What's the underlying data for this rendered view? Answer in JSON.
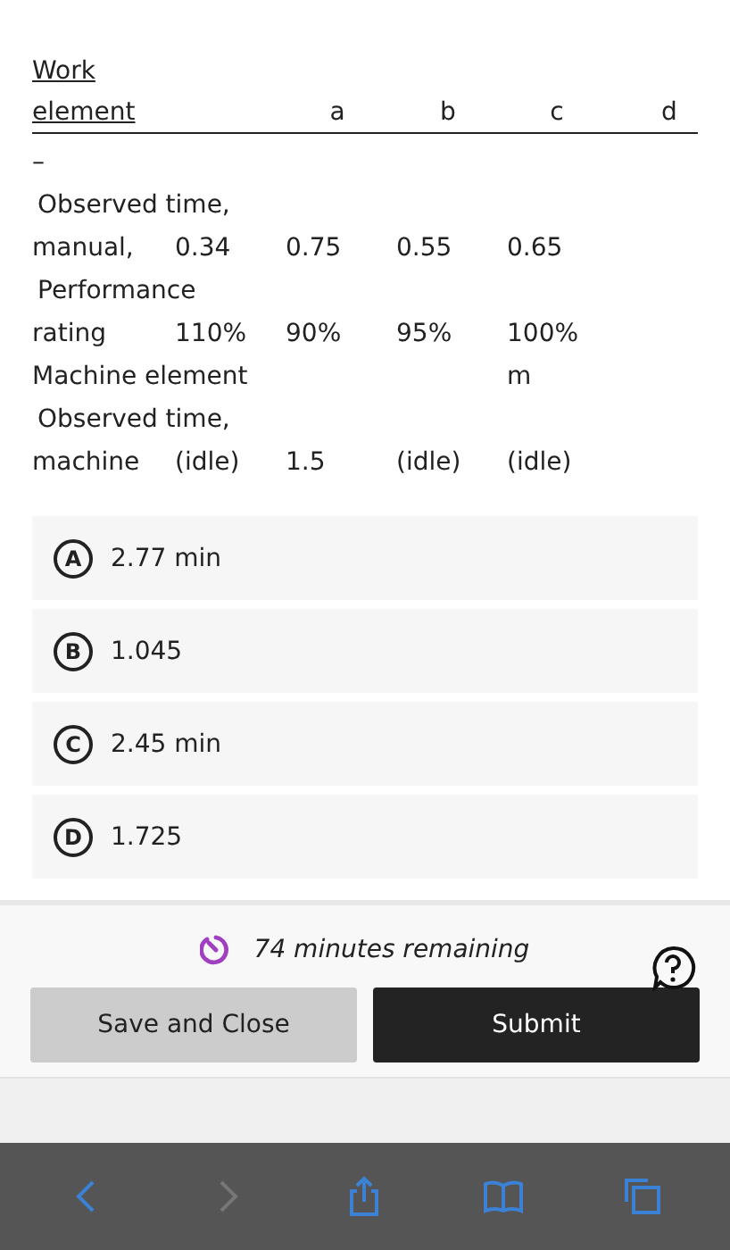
{
  "table": {
    "lines": [
      {
        "kind": "heading",
        "column_1": "Work"
      },
      {
        "kind": "header",
        "column_1": "element",
        "column_3": "a",
        "column_4": "b",
        "column_5": "c",
        "column_6": "d"
      },
      {
        "kind": "plain",
        "column_1": "–"
      },
      {
        "kind": "label",
        "column_1": "Observed time,"
      },
      {
        "kind": "values",
        "column_1": "manual,",
        "column_2": "0.34",
        "column_3": "0.75",
        "column_4": "0.55",
        "column_5": "0.65"
      },
      {
        "kind": "label",
        "column_1": "Performance"
      },
      {
        "kind": "values",
        "column_1": "rating",
        "column_2": "110%",
        "column_3": "90%",
        "column_4": "95%",
        "column_5": "100%"
      },
      {
        "kind": "values",
        "column_1": "Machine element",
        "column_5": "m"
      },
      {
        "kind": "label",
        "column_1": "Observed time,"
      },
      {
        "kind": "values",
        "column_1": "machine",
        "column_2": "(idle)",
        "column_3": "1.5",
        "column_4": "(idle)",
        "column_5": "(idle)"
      }
    ]
  },
  "options": [
    {
      "letter": "A",
      "text": "2.77 min"
    },
    {
      "letter": "B",
      "text": "1.045"
    },
    {
      "letter": "C",
      "text": "2.45 min"
    },
    {
      "letter": "D",
      "text": "1.725"
    }
  ],
  "footer": {
    "timer": "74 minutes remaining",
    "buttons": [
      {
        "label": "Save and Close",
        "kind": "secondary"
      },
      {
        "label": "Submit",
        "kind": "primary"
      }
    ]
  },
  "browser_toolbar": {
    "items": [
      {
        "kind": "back",
        "disabled": false
      },
      {
        "kind": "forward",
        "disabled": true
      },
      {
        "kind": "share",
        "disabled": false
      },
      {
        "kind": "bookmarks",
        "disabled": false
      },
      {
        "kind": "tabs",
        "disabled": false
      }
    ]
  }
}
